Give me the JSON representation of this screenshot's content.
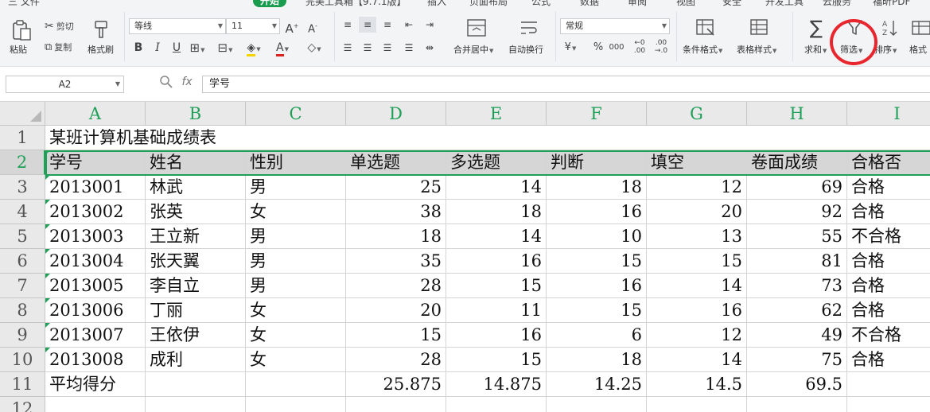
{
  "menu": {
    "items": [
      {
        "label": "三 文件",
        "x_hint": "left"
      },
      {
        "label": "开始",
        "active": true
      },
      {
        "label": "完美工具箱【9.7.1版】"
      },
      {
        "label": "插入"
      },
      {
        "label": "页面布局"
      },
      {
        "label": "公式"
      },
      {
        "label": "数据"
      },
      {
        "label": "审阅"
      },
      {
        "label": "视图"
      },
      {
        "label": "安全"
      },
      {
        "label": "开发工具"
      },
      {
        "label": "云服务"
      },
      {
        "label": "福昕PDF"
      }
    ]
  },
  "ribbon": {
    "paste_label": "粘贴",
    "cut_label": "剪切",
    "copy_label": "复制",
    "format_painter_label": "格式刷",
    "font_name": "等线",
    "font_size": "11",
    "merge_center_label": "合并居中",
    "wrap_text_label": "自动换行",
    "number_format": "常规",
    "percent_glyph": "%",
    "thousands_glyph": "000",
    "cond_format_label": "条件格式",
    "table_style_label": "表格样式",
    "sum_label": "求和",
    "filter_label": "筛选",
    "sort_label": "排序",
    "format_label": "格式"
  },
  "formula_bar": {
    "name_box": "A2",
    "fx": "fx",
    "content": "学号"
  },
  "sheet": {
    "columns": [
      "A",
      "B",
      "C",
      "D",
      "E",
      "F",
      "G",
      "H",
      "I"
    ],
    "row_numbers": [
      "1",
      "2",
      "3",
      "4",
      "5",
      "6",
      "7",
      "8",
      "9",
      "10",
      "11",
      "12"
    ],
    "title": "某班计算机基础成绩表",
    "headers": [
      "学号",
      "姓名",
      "性别",
      "单选题",
      "多选题",
      "判断",
      "填空",
      "卷面成绩",
      "合格否"
    ],
    "rows": [
      [
        "2013001",
        "林武",
        "男",
        "25",
        "14",
        "18",
        "12",
        "69",
        "合格"
      ],
      [
        "2013002",
        "张英",
        "女",
        "38",
        "18",
        "16",
        "20",
        "92",
        "合格"
      ],
      [
        "2013003",
        "王立新",
        "男",
        "18",
        "14",
        "10",
        "13",
        "55",
        "不合格"
      ],
      [
        "2013004",
        "张天翼",
        "男",
        "35",
        "16",
        "15",
        "15",
        "81",
        "合格"
      ],
      [
        "2013005",
        "李自立",
        "男",
        "28",
        "15",
        "16",
        "14",
        "73",
        "合格"
      ],
      [
        "2013006",
        "丁丽",
        "女",
        "20",
        "11",
        "15",
        "16",
        "62",
        "合格"
      ],
      [
        "2013007",
        "王依伊",
        "女",
        "15",
        "16",
        "6",
        "12",
        "49",
        "不合格"
      ],
      [
        "2013008",
        "成利",
        "女",
        "28",
        "15",
        "18",
        "14",
        "75",
        "合格"
      ]
    ],
    "average_row": [
      "平均得分",
      "",
      "",
      "25.875",
      "14.875",
      "14.25",
      "14.5",
      "69.5",
      ""
    ]
  },
  "colors": {
    "accent_green": "#1ea058",
    "highlight_red": "#e8262d"
  }
}
